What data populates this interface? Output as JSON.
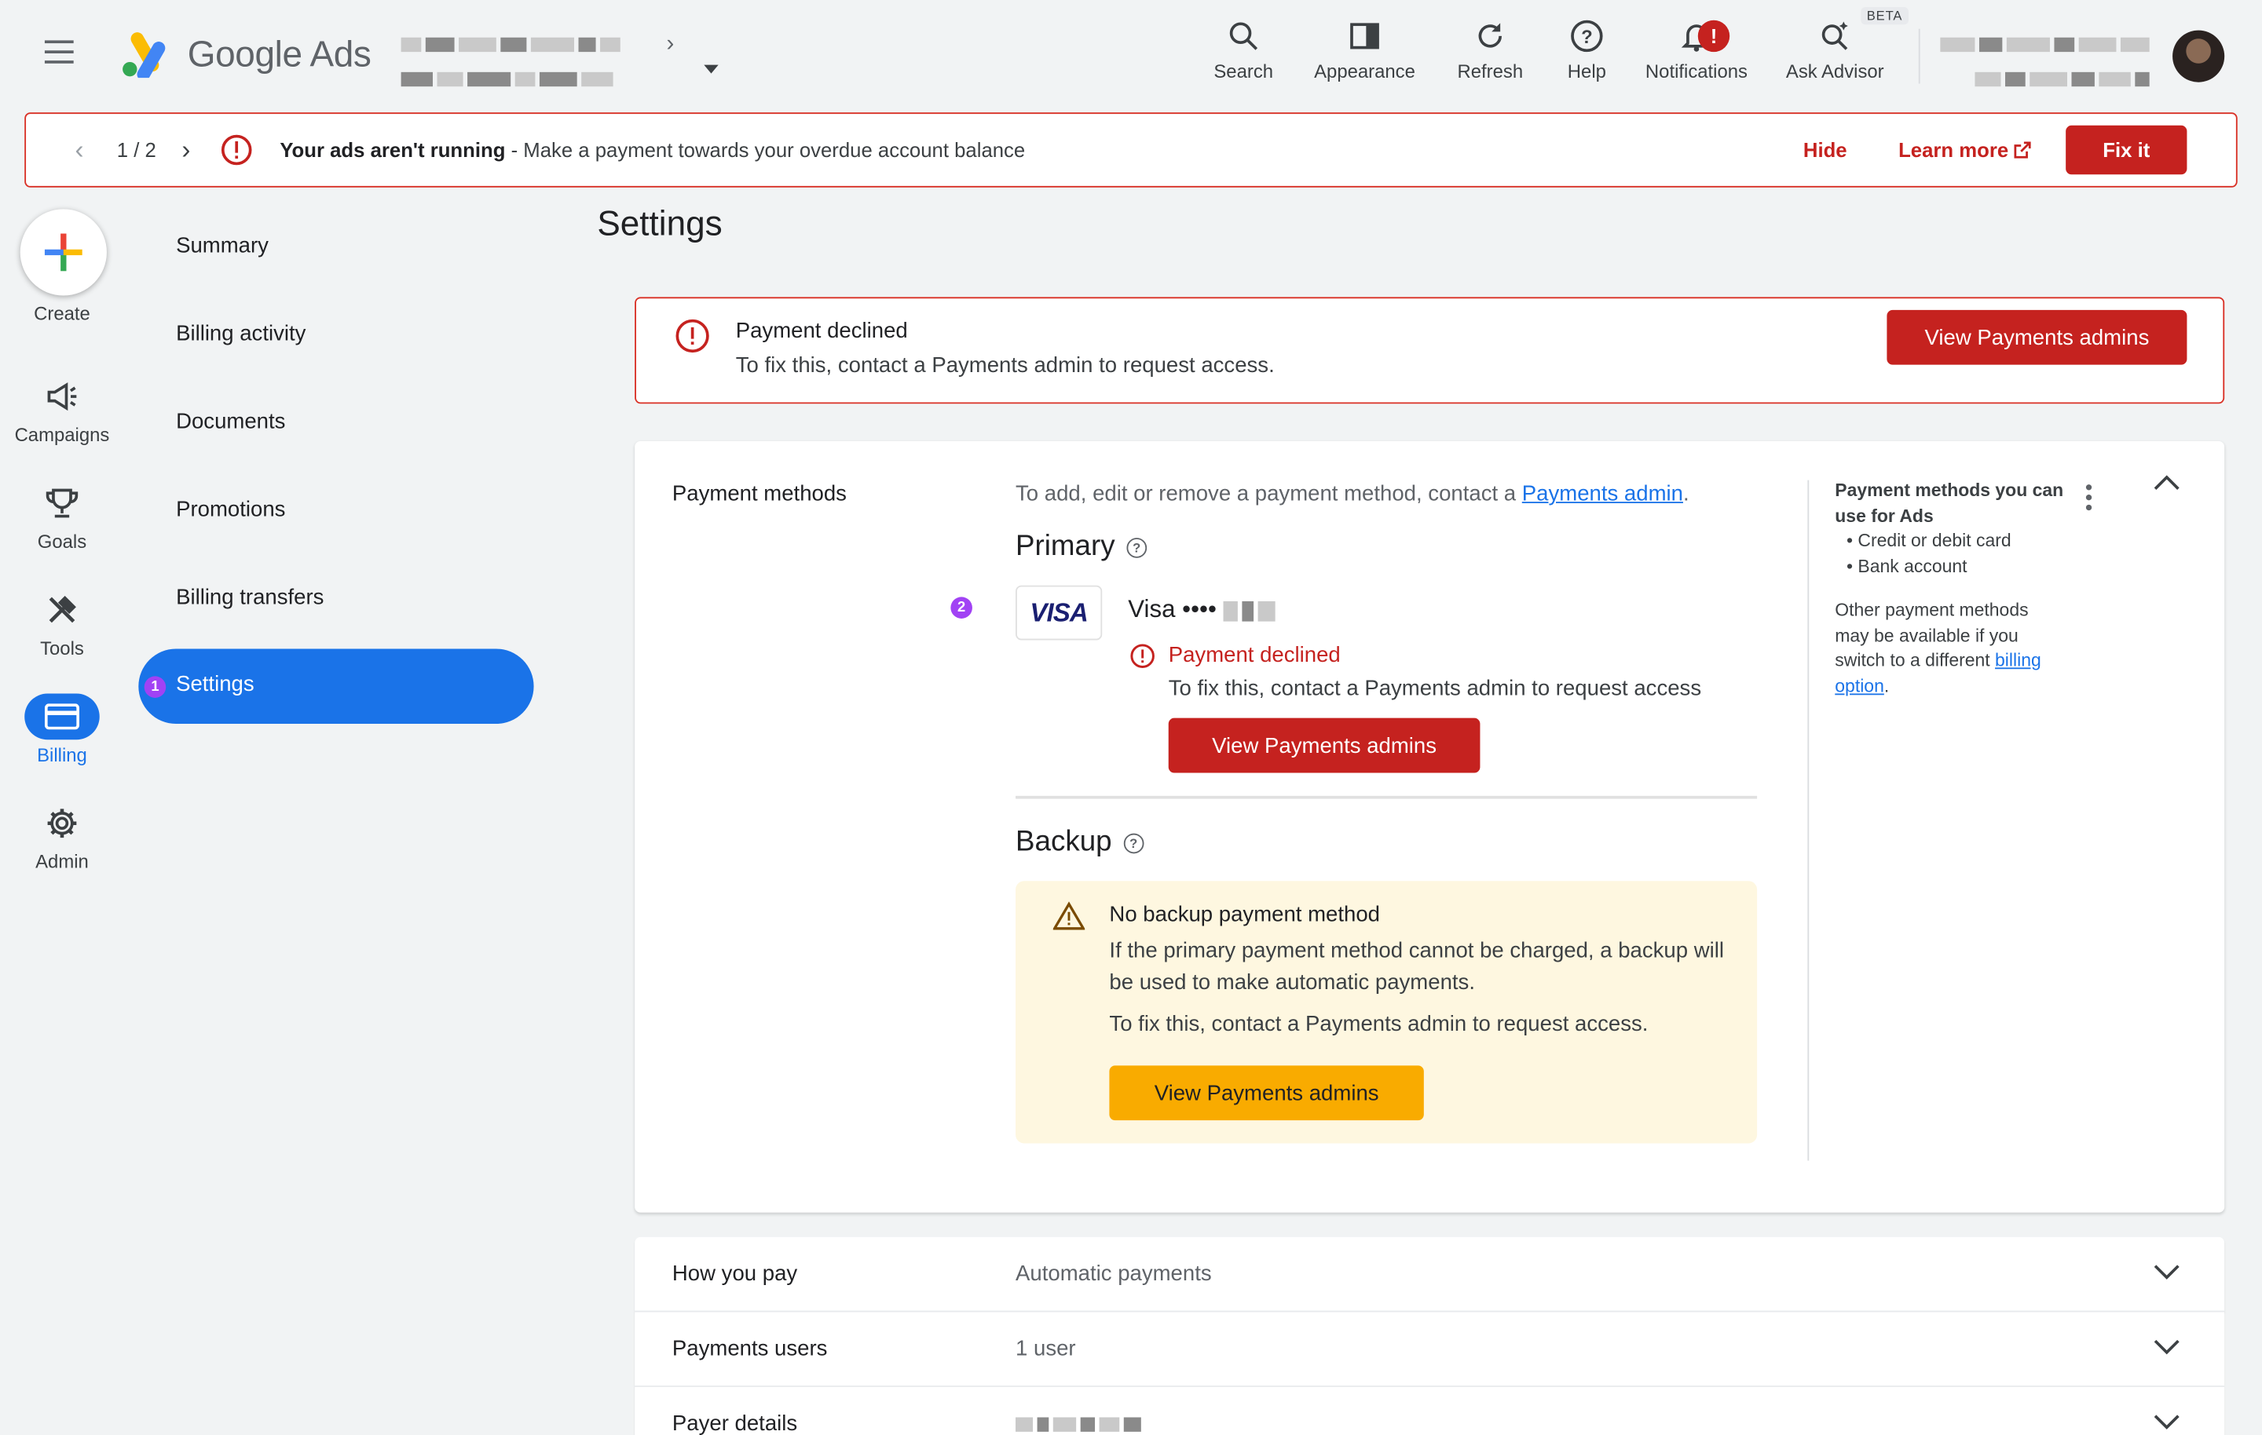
{
  "header": {
    "brand": "Google Ads",
    "toolbar": [
      {
        "label": "Search",
        "icon": "search-icon"
      },
      {
        "label": "Appearance",
        "icon": "appearance-icon"
      },
      {
        "label": "Refresh",
        "icon": "refresh-icon"
      },
      {
        "label": "Help",
        "icon": "help-icon"
      },
      {
        "label": "Notifications",
        "icon": "bell-icon",
        "badge": "!"
      },
      {
        "label": "Ask Advisor",
        "icon": "advisor-icon",
        "tag": "BETA"
      }
    ]
  },
  "banner": {
    "pager": "1 / 2",
    "headline": "Your ads aren't running",
    "message": " - Make a payment towards your overdue account balance",
    "hide": "Hide",
    "learn_more": "Learn more",
    "fix": "Fix it"
  },
  "rail": {
    "create": "Create",
    "items": [
      {
        "label": "Campaigns",
        "icon": "megaphone-icon"
      },
      {
        "label": "Goals",
        "icon": "trophy-icon"
      },
      {
        "label": "Tools",
        "icon": "tools-icon"
      },
      {
        "label": "Billing",
        "icon": "credit-card-icon",
        "active": true
      },
      {
        "label": "Admin",
        "icon": "gear-icon"
      }
    ]
  },
  "subnav": {
    "items": [
      "Summary",
      "Billing activity",
      "Documents",
      "Promotions",
      "Billing transfers",
      "Settings"
    ],
    "active": "Settings",
    "step_badge_1": "1",
    "step_badge_2": "2"
  },
  "page": {
    "title": "Settings",
    "declined": {
      "title": "Payment declined",
      "desc": "To fix this, contact a Payments admin to request access.",
      "button": "View Payments admins"
    },
    "payment_methods": {
      "label": "Payment methods",
      "intro_prefix": "To add, edit or remove a payment method, contact a ",
      "intro_link": "Payments admin",
      "intro_suffix": ".",
      "primary_heading": "Primary",
      "card_brand": "VISA",
      "card_name": "Visa ••••",
      "primary_status": "Payment declined",
      "primary_desc": "To fix this, contact a Payments admin to request access",
      "primary_button": "View Payments admins",
      "backup_heading": "Backup",
      "backup_title": "No backup payment method",
      "backup_desc": "If the primary payment method cannot be charged, a backup will be used to make automatic payments.",
      "backup_fix": "To fix this, contact a Payments admin to request access.",
      "backup_button": "View Payments admins",
      "side_title": "Payment methods you can use for Ads",
      "side_items": [
        "Credit or debit card",
        "Bank account"
      ],
      "side_other_prefix": "Other payment methods may be available if you switch to a different ",
      "side_other_link": "billing option",
      "side_other_suffix": "."
    },
    "rows": [
      {
        "label": "How you pay",
        "value": "Automatic payments"
      },
      {
        "label": "Payments users",
        "value": "1 user"
      },
      {
        "label": "Payer details",
        "value": ""
      }
    ]
  },
  "colors": {
    "accent": "#1a73e8",
    "error": "#c5221f",
    "warning_bg": "#fef7e0",
    "warning_button": "#f9ab00"
  }
}
